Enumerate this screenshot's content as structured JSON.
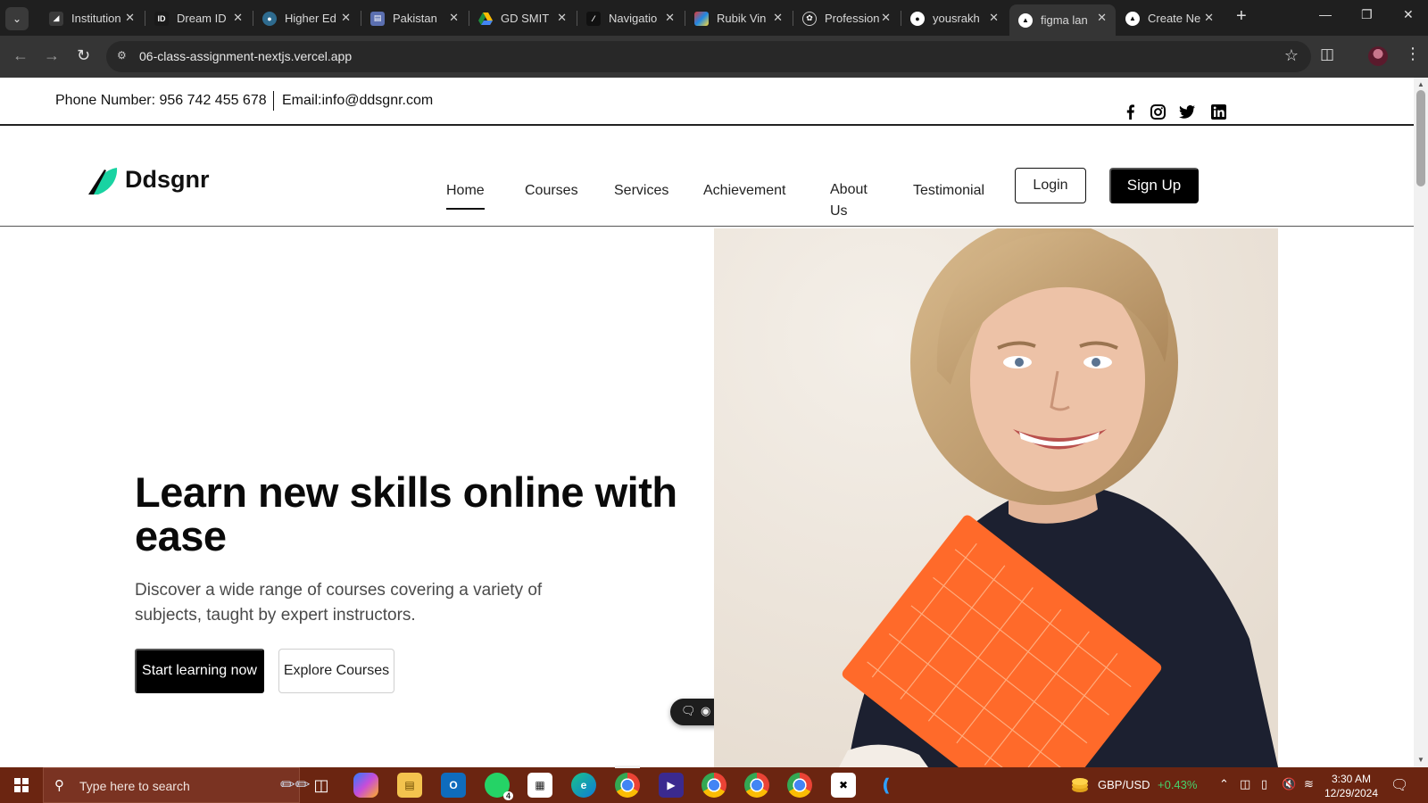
{
  "browser": {
    "tabs": [
      {
        "label": "Institution",
        "icon": "institution-icon",
        "color": "#3a3a3a"
      },
      {
        "label": "Dream ID",
        "icon": "id-icon",
        "color": "#1a1a1a"
      },
      {
        "label": "Higher Ed",
        "icon": "hec-icon",
        "color": "#2e6b8f"
      },
      {
        "label": "Pakistan",
        "icon": "pakistan-icon",
        "color": "#5b6fb0"
      },
      {
        "label": "GD SMIT",
        "icon": "google-drive-icon",
        "color": "#1e8e3e"
      },
      {
        "label": "Navigatio",
        "icon": "nextjs-icon",
        "color": "#111111"
      },
      {
        "label": "Rubik Vin",
        "icon": "rubik-icon",
        "color": "#c23b3b"
      },
      {
        "label": "Profession",
        "icon": "chatgpt-icon",
        "color": "#444444"
      },
      {
        "label": "yousrakh",
        "icon": "github-icon",
        "color": "#222222"
      },
      {
        "label": "figma lan",
        "icon": "vercel-icon",
        "color": "#000000",
        "active": true
      },
      {
        "label": "Create Ne",
        "icon": "vercel-icon",
        "color": "#000000"
      }
    ],
    "url": "06-class-assignment-nextjs.vercel.app"
  },
  "site": {
    "topbar": {
      "phone": "Phone Number: 956 742 455 678",
      "email": "Email:info@ddsgnr.com"
    },
    "logo": "Ddsgnr",
    "nav": {
      "home": "Home",
      "courses": "Courses",
      "services": "Services",
      "achievement": "Achievement",
      "about": "About Us",
      "testimonial": "Testimonial"
    },
    "login": "Login",
    "signup": "Sign Up",
    "hero": {
      "title": "Learn new skills online with ease",
      "subtitle": "Discover a wide range of courses covering a variety of subjects, taught by expert instructors.",
      "primary_cta": "Start learning now",
      "secondary_cta": "Explore Courses"
    }
  },
  "taskbar": {
    "search_placeholder": "Type here to search",
    "ticker_symbol": "GBP/USD",
    "ticker_change": "+0.43%",
    "time": "3:30 AM",
    "date": "12/29/2024",
    "whatsapp_badge": "4"
  },
  "colors": {
    "accent": "#000000",
    "logo_green": "#19d3a2",
    "taskbar": "#6b2511"
  }
}
